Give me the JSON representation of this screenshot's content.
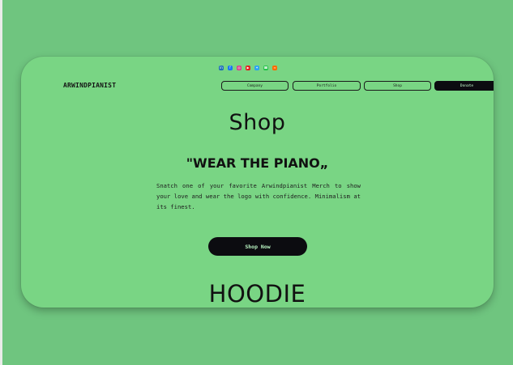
{
  "header": {
    "brand": "ARWINDPIANIST",
    "social": [
      {
        "name": "linkedin-icon",
        "glyph": "in",
        "color": "#1d6fb8"
      },
      {
        "name": "facebook-icon",
        "glyph": "f",
        "color": "#1877f2"
      },
      {
        "name": "instagram-icon",
        "glyph": "◎",
        "color": "#d9418b"
      },
      {
        "name": "youtube-icon",
        "glyph": "▶",
        "color": "#e21b1b"
      },
      {
        "name": "twitter-icon",
        "glyph": "✦",
        "color": "#2aa3f0"
      },
      {
        "name": "whatsapp-icon",
        "glyph": "☎",
        "color": "#25c24a"
      },
      {
        "name": "soundcloud-icon",
        "glyph": "≈",
        "color": "#ff6a00"
      }
    ],
    "nav": {
      "company": "Company",
      "portfolio": "Portfolio",
      "shop": "Shop",
      "donate": "Donate"
    }
  },
  "main": {
    "title": "Shop",
    "subtitle": "\"WEAR THE PIANO„",
    "description": "Snatch one of your favorite Arwindpianist Merch to show your love and wear the logo with confidence. Minimalism at its finest.",
    "cta": "Shop Now",
    "product_heading": "HOODIE"
  }
}
